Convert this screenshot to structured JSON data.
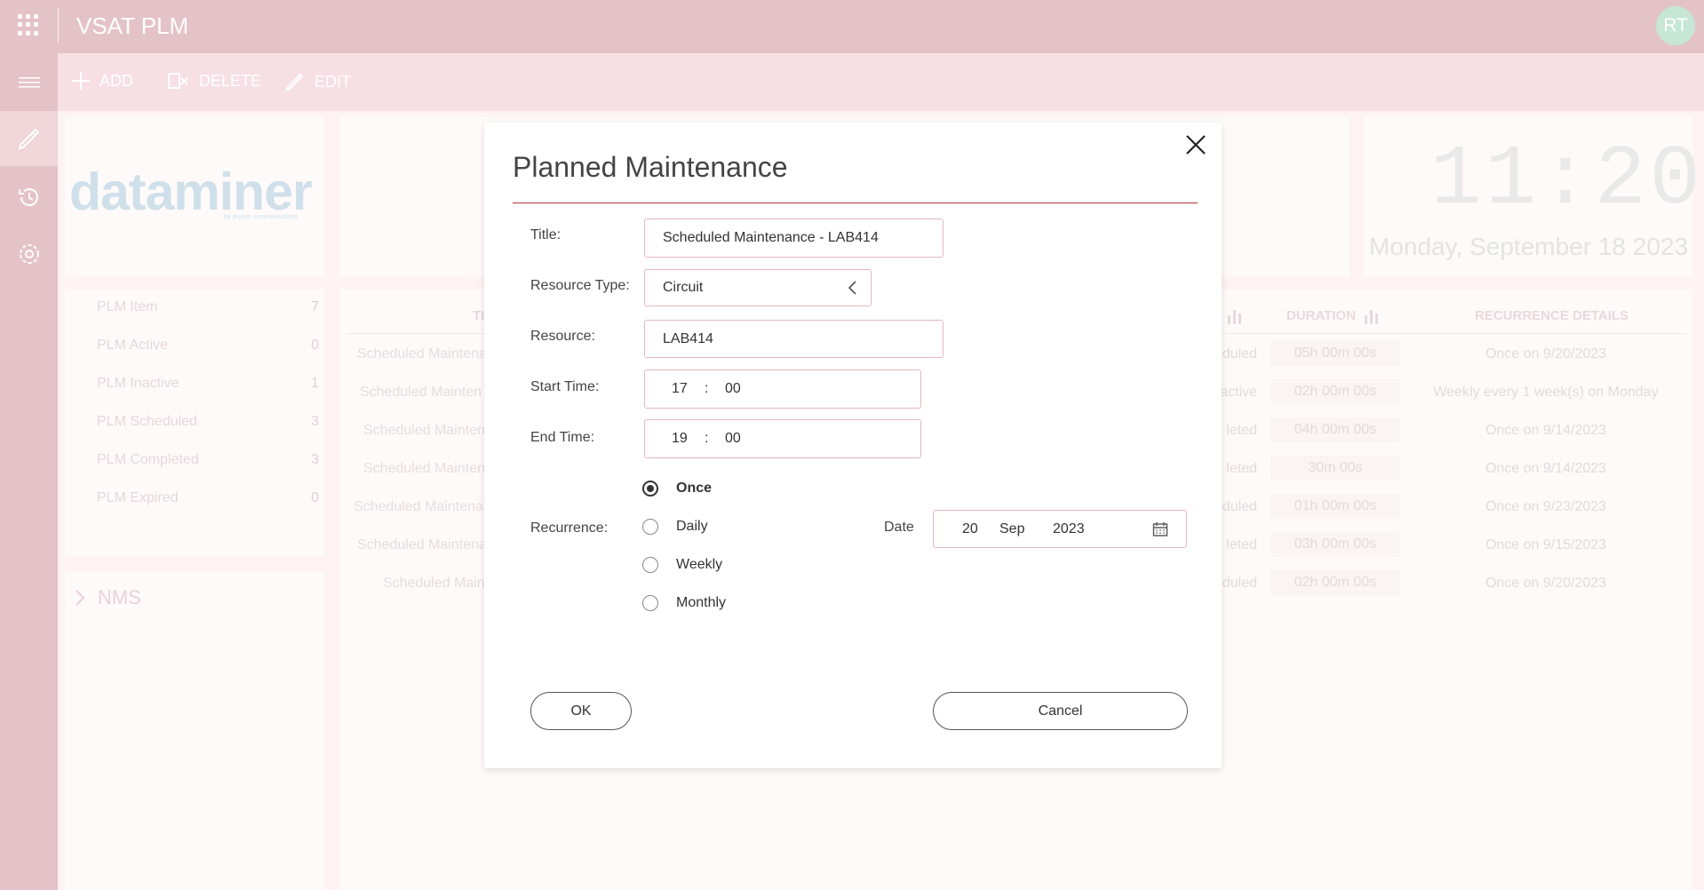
{
  "app": {
    "title": "VSAT PLM",
    "avatar_initials": "RT"
  },
  "toolbar": {
    "add_label": "ADD",
    "delete_label": "DELETE",
    "edit_label": "EDIT"
  },
  "logo": {
    "text": "dataminer",
    "sub": "by skyline communications"
  },
  "clock": {
    "time": "11:20",
    "date": "Monday, September 18 2023"
  },
  "stats": [
    {
      "label": "PLM Item",
      "count": "7"
    },
    {
      "label": "PLM Active",
      "count": "0"
    },
    {
      "label": "PLM Inactive",
      "count": "1"
    },
    {
      "label": "PLM Scheduled",
      "count": "3"
    },
    {
      "label": "PLM Completed",
      "count": "3"
    },
    {
      "label": "PLM Expired",
      "count": "0"
    }
  ],
  "nms_label": "NMS",
  "table": {
    "headers": {
      "title": "TI",
      "duration": "DURATION",
      "recurrence": "RECURRENCE DETAILS"
    },
    "rows": [
      {
        "title": "Scheduled Maintena",
        "status": "duled",
        "duration": "05h 00m 00s",
        "recurrence": "Once on 9/20/2023"
      },
      {
        "title": "Scheduled Mainten",
        "status": "active",
        "duration": "02h 00m 00s",
        "recurrence": "Weekly every 1 week(s) on Monday"
      },
      {
        "title": "Scheduled Mainten",
        "status": "leted",
        "duration": "04h 00m 00s",
        "recurrence": "Once on 9/14/2023"
      },
      {
        "title": "Scheduled Mainten",
        "status": "leted",
        "duration": "30m 00s",
        "recurrence": "Once on 9/14/2023"
      },
      {
        "title": "Scheduled Maintena",
        "status": "duled",
        "duration": "01h 00m 00s",
        "recurrence": "Once on 9/23/2023"
      },
      {
        "title": "Scheduled Maintena",
        "status": "leted",
        "duration": "03h 00m 00s",
        "recurrence": "Once on 9/15/2023"
      },
      {
        "title": "Scheduled Main",
        "status": "duled",
        "duration": "02h 00m 00s",
        "recurrence": "Once on 9/20/2023"
      }
    ]
  },
  "dialog": {
    "title": "Planned Maintenance",
    "title_label": "Title:",
    "title_value": "Scheduled Maintenance - LAB414",
    "resource_type_label": "Resource Type:",
    "resource_type_value": "Circuit",
    "resource_label": "Resource:",
    "resource_value": "LAB414",
    "start_time_label": "Start Time:",
    "start_hour": "17",
    "start_minute": "00",
    "end_time_label": "End Time:",
    "end_hour": "19",
    "end_minute": "00",
    "time_separator": ":",
    "recurrence_label": "Recurrence:",
    "recurrence_options": [
      "Once",
      "Daily",
      "Weekly",
      "Monthly"
    ],
    "recurrence_selected": "Once",
    "date_label": "Date",
    "date_day": "20",
    "date_month": "Sep",
    "date_year": "2023",
    "ok_label": "OK",
    "cancel_label": "Cancel"
  }
}
